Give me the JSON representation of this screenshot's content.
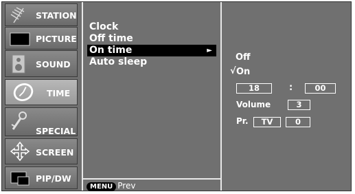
{
  "sidebar": {
    "items": [
      {
        "label": "STATION",
        "icon": "antenna-icon"
      },
      {
        "label": "PICTURE",
        "icon": "monitor-icon"
      },
      {
        "label": "SOUND",
        "icon": "speaker-icon"
      },
      {
        "label": "TIME",
        "icon": "clock-icon",
        "selected": true
      },
      {
        "label": "SPECIAL",
        "icon": "key-icon"
      },
      {
        "label": "SCREEN",
        "icon": "move-arrows-icon"
      },
      {
        "label": "PIP/DW",
        "icon": "pip-icon"
      }
    ]
  },
  "menu": {
    "items": [
      "Clock",
      "Off time",
      "On time",
      "Auto sleep"
    ],
    "active_index": 2,
    "arrow": "►"
  },
  "footer": {
    "menu_key": "MENU",
    "prev_label": "Prev"
  },
  "panel": {
    "off_label": "Off",
    "on_label": "On",
    "check": "√",
    "hour": "18",
    "separator": ":",
    "minute": "00",
    "volume_label": "Volume",
    "volume_value": "3",
    "program_label": "Pr.",
    "program_source": "TV",
    "program_number": "0"
  },
  "colors": {
    "background": "#707070",
    "highlight": "#000000",
    "text": "#ffffff"
  }
}
